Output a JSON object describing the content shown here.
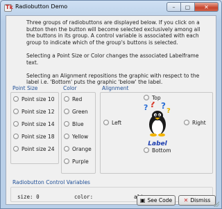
{
  "window": {
    "title": "Radiobutton Demo",
    "app_icon": "tk-feather-icon"
  },
  "intro": {
    "p1": "Three groups of radiobuttons are displayed below.  If you click on a button then the button will become selected exclusively among all the buttons in its group. A control variable is associated with each group to indicate which of the group's buttons is selected.",
    "p2": "Selecting a Point Size or Color changes the associated Labelframe text.",
    "p3": "Selecting an Alignment repositions the graphic with respect to the label i.e. 'Bottom' puts the graphic 'below' the label."
  },
  "groups": {
    "point_size": {
      "label": "Point Size",
      "options": [
        "Point size 10",
        "Point size 12",
        "Point size 14",
        "Point size 18",
        "Point size 24"
      ]
    },
    "color": {
      "label": "Color",
      "options": [
        "Red",
        "Green",
        "Blue",
        "Yellow",
        "Orange",
        "Purple"
      ]
    },
    "alignment": {
      "label": "Alignment",
      "top": "Top",
      "left": "Left",
      "right": "Right",
      "bottom": "Bottom",
      "image_label": "Label"
    }
  },
  "variables": {
    "label": "Radiobutton Control Variables",
    "size_label": "size:",
    "size_value": "0",
    "color_label": "color:",
    "align_label": "align:"
  },
  "buttons": {
    "see_code": "See Code",
    "dismiss": "Dismiss"
  },
  "colors": {
    "accent": "#1f4f97",
    "label_text": "#1e3fb0"
  }
}
